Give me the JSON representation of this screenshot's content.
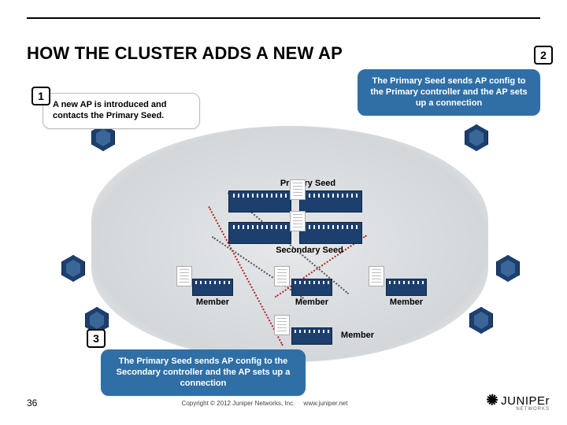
{
  "title": "HOW THE CLUSTER ADDS A NEW AP",
  "callouts": {
    "c1": {
      "num": "1",
      "text": "A new AP is introduced and contacts the Primary Seed."
    },
    "c2": {
      "num": "2",
      "text": "The Primary Seed sends AP config to the Primary controller and the AP sets up a connection"
    },
    "c3": {
      "num": "3",
      "text": "The Primary Seed sends AP config to the Secondary controller and the AP sets up a connection"
    }
  },
  "labels": {
    "primarySeed": "Primary Seed",
    "secondarySeed": "Secondary Seed",
    "member": "Member"
  },
  "footer": {
    "slide": "36",
    "copyright": "Copyright © 2012 Juniper Networks, Inc.",
    "url": "www.juniper.net",
    "brand": "JUNIPEr",
    "brandSub": "NETWORKS"
  }
}
